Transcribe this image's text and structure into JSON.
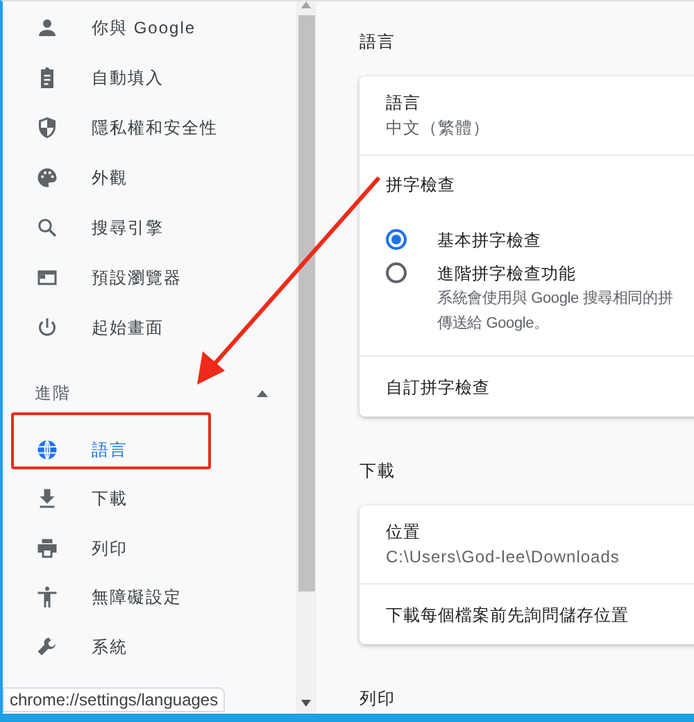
{
  "sidebar": {
    "items": [
      {
        "label": "你與 Google",
        "selected": false
      },
      {
        "label": "自動填入",
        "selected": false
      },
      {
        "label": "隱私權和安全性",
        "selected": false
      },
      {
        "label": "外觀",
        "selected": false
      },
      {
        "label": "搜尋引擎",
        "selected": false
      },
      {
        "label": "預設瀏覽器",
        "selected": false
      },
      {
        "label": "起始畫面",
        "selected": false
      }
    ],
    "advanced": {
      "label": "進階",
      "expanded": true,
      "items": [
        {
          "label": "語言",
          "selected": true
        },
        {
          "label": "下載",
          "selected": false
        },
        {
          "label": "列印",
          "selected": false
        },
        {
          "label": "無障礙設定",
          "selected": false
        },
        {
          "label": "系統",
          "selected": false
        }
      ]
    }
  },
  "sections": [
    {
      "title": "語言",
      "rows": [
        {
          "kind": "value",
          "label": "語言",
          "value": "中文（繁體）"
        },
        {
          "kind": "radios",
          "label": "拼字檢查",
          "options": [
            {
              "label": "基本拼字檢查",
              "selected": true
            },
            {
              "label": "進階拼字檢查功能",
              "description": [
                "系統會使用與 Google 搜尋相同的拼",
                "傳送給 Google。"
              ],
              "selected": false
            }
          ]
        },
        {
          "kind": "link",
          "label": "自訂拼字檢查"
        }
      ]
    },
    {
      "title": "下載",
      "rows": [
        {
          "kind": "value",
          "label": "位置",
          "value": "C:\\Users\\God-lee\\Downloads"
        },
        {
          "kind": "link",
          "label": "下載每個檔案前先詢問儲存位置"
        }
      ]
    },
    {
      "title": "列印"
    }
  ],
  "status_url": "chrome://settings/languages"
}
